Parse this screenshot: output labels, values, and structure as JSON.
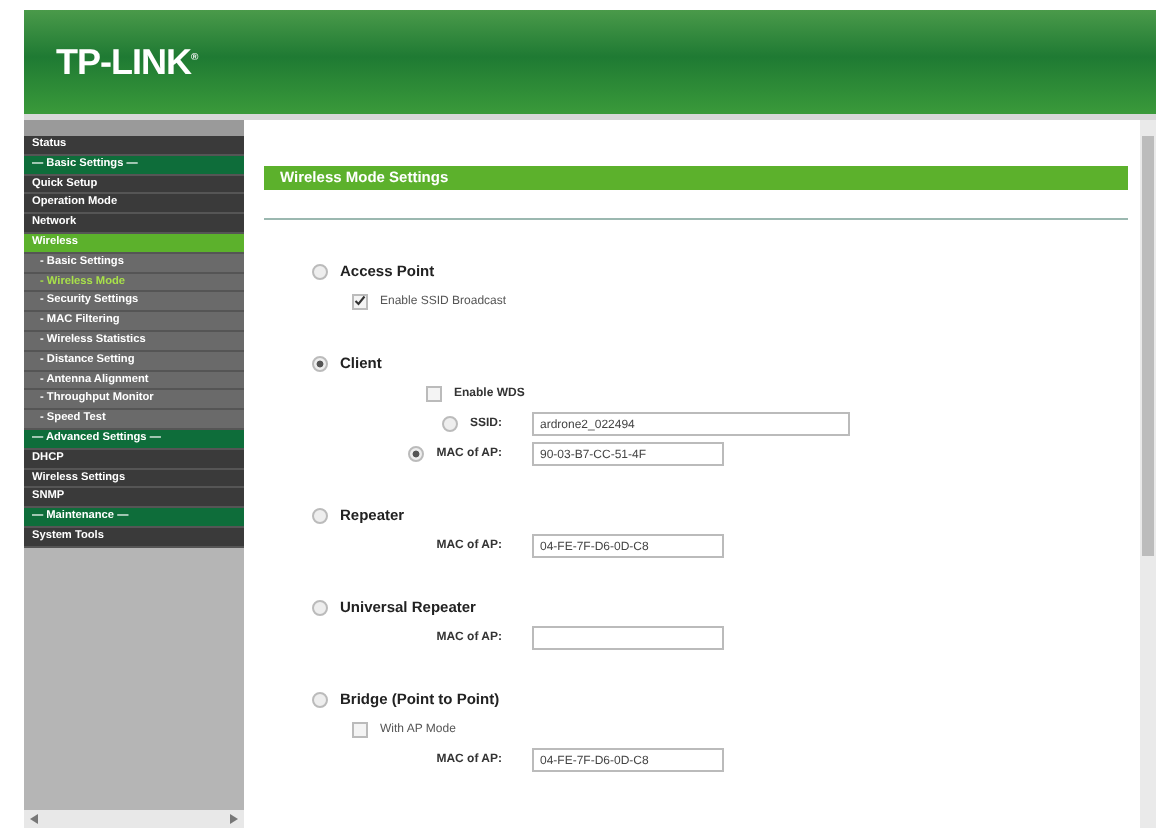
{
  "brand": {
    "logo": "TP-LINK",
    "mark": "®"
  },
  "menu": [
    {
      "label": "Status",
      "kind": "item",
      "selected": false
    },
    {
      "label": "— Basic Settings —",
      "kind": "header"
    },
    {
      "label": "Quick Setup",
      "kind": "item",
      "selected": false
    },
    {
      "label": "Operation Mode",
      "kind": "item",
      "selected": false
    },
    {
      "label": "Network",
      "kind": "item",
      "selected": false
    },
    {
      "label": "Wireless",
      "kind": "item",
      "selected": true
    },
    {
      "label": "- Basic Settings",
      "kind": "sub",
      "selected": false
    },
    {
      "label": "- Wireless Mode",
      "kind": "sub",
      "selected": true
    },
    {
      "label": "- Security Settings",
      "kind": "sub",
      "selected": false
    },
    {
      "label": "- MAC Filtering",
      "kind": "sub",
      "selected": false
    },
    {
      "label": "- Wireless Statistics",
      "kind": "sub",
      "selected": false
    },
    {
      "label": "- Distance Setting",
      "kind": "sub",
      "selected": false
    },
    {
      "label": "- Antenna Alignment",
      "kind": "sub",
      "selected": false
    },
    {
      "label": "- Throughput Monitor",
      "kind": "sub",
      "selected": false
    },
    {
      "label": "- Speed Test",
      "kind": "sub",
      "selected": false
    },
    {
      "label": "— Advanced Settings —",
      "kind": "header"
    },
    {
      "label": "DHCP",
      "kind": "item",
      "selected": false
    },
    {
      "label": "Wireless Settings",
      "kind": "item",
      "selected": false
    },
    {
      "label": "SNMP",
      "kind": "item",
      "selected": false
    },
    {
      "label": "— Maintenance —",
      "kind": "header"
    },
    {
      "label": "System Tools",
      "kind": "item",
      "selected": false
    }
  ],
  "panel": {
    "title": "Wireless Mode Settings",
    "modes": [
      {
        "label": "Access Point",
        "selected": false,
        "fields": [
          {
            "kind": "checkbox",
            "label": "Enable SSID Broadcast",
            "checked": true
          }
        ]
      },
      {
        "label": "Client",
        "selected": true,
        "fields": [
          {
            "kind": "bold-checkbox",
            "label": "Enable WDS",
            "checked": false
          },
          {
            "kind": "radio-input",
            "label": "SSID:",
            "selected": false,
            "value": "ardrone2_022494",
            "wide": true
          },
          {
            "kind": "radio-input",
            "label": "MAC of AP:",
            "selected": true,
            "value": "90-03-B7-CC-51-4F"
          }
        ]
      },
      {
        "label": "Repeater",
        "selected": false,
        "fields": [
          {
            "kind": "input",
            "label": "MAC of AP:",
            "value": "04-FE-7F-D6-0D-C8"
          }
        ]
      },
      {
        "label": "Universal Repeater",
        "selected": false,
        "fields": [
          {
            "kind": "input",
            "label": "MAC of AP:"
          }
        ]
      },
      {
        "label": "Bridge (Point to Point)",
        "selected": false,
        "fields": [
          {
            "kind": "checkbox",
            "label": "With AP Mode",
            "checked": false
          },
          {
            "kind": "input",
            "label": "MAC of AP:",
            "value": "04-FE-7F-D6-0D-C8"
          }
        ]
      }
    ]
  }
}
